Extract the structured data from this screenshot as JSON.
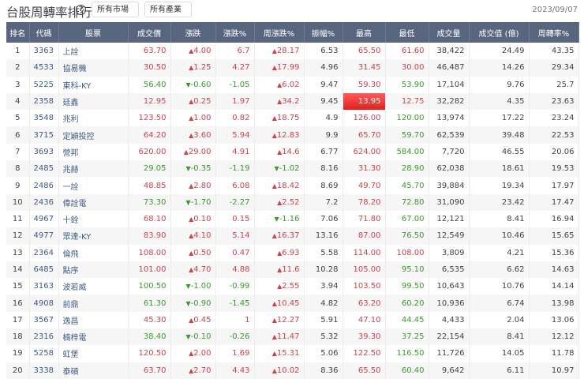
{
  "header": {
    "title": "台股周轉率排行",
    "help_icon": "?",
    "market_select": "所有市場",
    "industry_select": "所有產業",
    "date": "2023/09/07"
  },
  "colors": {
    "up": "#cf4250",
    "down": "#3b9a2c",
    "header_bg": "#58657f"
  },
  "columns": [
    "排名",
    "代碼",
    "股票",
    "成交價",
    "漲跌",
    "漲跌%",
    "周漲跌%",
    "振幅%",
    "最高",
    "最低",
    "成交量",
    "成交值 (億)",
    "周轉率%"
  ],
  "limit_up_high_codes": [
    "2358"
  ],
  "rows": [
    [
      "1",
      "3363",
      "上詮",
      "63.70",
      "4.00",
      "6.7",
      "28.17",
      "6.53",
      "65.50",
      "61.60",
      "38,422",
      "24.49",
      "43.35"
    ],
    [
      "2",
      "4533",
      "協易機",
      "30.50",
      "1.25",
      "4.27",
      "17.99",
      "4.96",
      "31.45",
      "30.00",
      "46,487",
      "14.26",
      "29.34"
    ],
    [
      "3",
      "5225",
      "東科-KY",
      "56.40",
      "-0.60",
      "-1.05",
      "6.02",
      "9.47",
      "59.30",
      "53.90",
      "17,104",
      "9.76",
      "25.7"
    ],
    [
      "4",
      "2358",
      "廷鑫",
      "12.95",
      "0.25",
      "1.97",
      "34.2",
      "9.45",
      "13.95",
      "12.75",
      "32,282",
      "4.35",
      "23.63"
    ],
    [
      "5",
      "3548",
      "兆利",
      "123.50",
      "1.00",
      "0.82",
      "18.75",
      "4.9",
      "126.00",
      "120.00",
      "13,974",
      "17.22",
      "23.24"
    ],
    [
      "6",
      "3715",
      "定穎投控",
      "64.20",
      "3.60",
      "5.94",
      "12.83",
      "9.9",
      "65.70",
      "59.70",
      "62,539",
      "39.48",
      "22.53"
    ],
    [
      "7",
      "3693",
      "營邦",
      "620.00",
      "29.00",
      "4.91",
      "14.6",
      "6.77",
      "624.00",
      "584.00",
      "7,720",
      "46.55",
      "20.06"
    ],
    [
      "8",
      "2485",
      "兆赫",
      "29.05",
      "-0.35",
      "-1.19",
      "-1.02",
      "8.16",
      "31.30",
      "28.90",
      "62,038",
      "18.61",
      "19.53"
    ],
    [
      "9",
      "2486",
      "一詮",
      "48.85",
      "2.80",
      "6.08",
      "18.42",
      "8.69",
      "49.70",
      "45.70",
      "39,884",
      "19.34",
      "17.97"
    ],
    [
      "10",
      "2436",
      "偉詮電",
      "73.30",
      "-1.70",
      "-2.27",
      "2.52",
      "7.2",
      "78.20",
      "72.80",
      "31,090",
      "23.42",
      "17.47"
    ],
    [
      "11",
      "4967",
      "十銓",
      "68.10",
      "0.10",
      "0.15",
      "-1.16",
      "7.06",
      "71.80",
      "67.00",
      "12,121",
      "8.41",
      "16.94"
    ],
    [
      "12",
      "4977",
      "眾達-KY",
      "83.90",
      "4.10",
      "5.14",
      "16.37",
      "13.16",
      "87.00",
      "76.50",
      "12,549",
      "10.46",
      "15.65"
    ],
    [
      "13",
      "2364",
      "倫飛",
      "108.00",
      "0.50",
      "0.47",
      "6.93",
      "5.58",
      "114.00",
      "108.00",
      "3,809",
      "4.21",
      "15.36"
    ],
    [
      "14",
      "6485",
      "點序",
      "101.00",
      "4.70",
      "4.88",
      "11.6",
      "10.28",
      "105.00",
      "95.10",
      "6,535",
      "6.62",
      "14.63"
    ],
    [
      "15",
      "3163",
      "波若威",
      "100.50",
      "-1.00",
      "-0.99",
      "2.55",
      "3.94",
      "103.50",
      "99.50",
      "10,643",
      "10.76",
      "14.14"
    ],
    [
      "16",
      "4908",
      "前鼎",
      "61.30",
      "-0.90",
      "-1.45",
      "10.45",
      "4.82",
      "63.20",
      "60.20",
      "10,936",
      "6.74",
      "13.98"
    ],
    [
      "17",
      "3567",
      "逸昌",
      "45.30",
      "0.45",
      "1",
      "12.27",
      "5.91",
      "47.10",
      "44.45",
      "4,433",
      "2.04",
      "13.06"
    ],
    [
      "18",
      "2316",
      "楠梓電",
      "38.40",
      "-0.10",
      "-0.26",
      "11.47",
      "5.32",
      "39.30",
      "37.25",
      "22,154",
      "8.41",
      "12.12"
    ],
    [
      "19",
      "5258",
      "虹堡",
      "120.50",
      "2.00",
      "1.69",
      "15.31",
      "5.06",
      "122.50",
      "116.50",
      "11,726",
      "14.05",
      "11.78"
    ],
    [
      "20",
      "3338",
      "泰碩",
      "63.70",
      "2.70",
      "4.43",
      "10.02",
      "8.36",
      "65.50",
      "60.40",
      "9,642",
      "6.11",
      "10.97"
    ]
  ]
}
